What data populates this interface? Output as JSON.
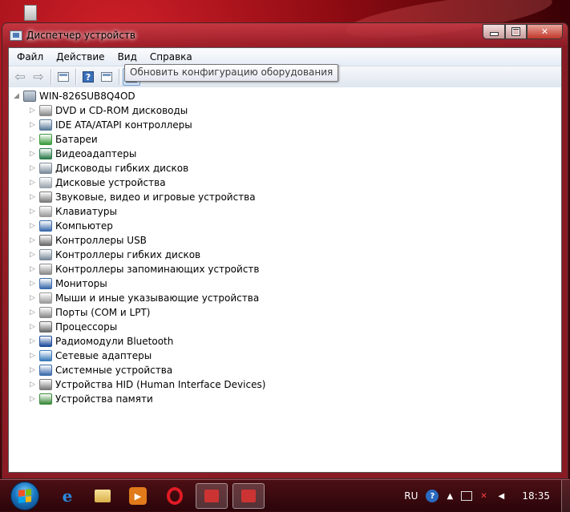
{
  "window": {
    "title": "Диспетчер устройств"
  },
  "menu": [
    "Файл",
    "Действие",
    "Вид",
    "Справка"
  ],
  "toolbar": {
    "tooltip": "Обновить конфигурацию оборудования"
  },
  "tree": {
    "root": "WIN-826SUB8Q4OD",
    "items": [
      {
        "label": "DVD и CD-ROM дисководы",
        "icon": "dvd-drive-icon",
        "color": "#8a8a8a"
      },
      {
        "label": "IDE ATA/ATAPI контроллеры",
        "icon": "ide-controller-icon",
        "color": "#5a7a9a"
      },
      {
        "label": "Батареи",
        "icon": "battery-icon",
        "color": "#3a9a3a"
      },
      {
        "label": "Видеоадаптеры",
        "icon": "video-adapter-icon",
        "color": "#2a7a4a"
      },
      {
        "label": "Дисководы гибких дисков",
        "icon": "floppy-drive-icon",
        "color": "#7a8a9a"
      },
      {
        "label": "Дисковые устройства",
        "icon": "disk-drive-icon",
        "color": "#9aa4ae"
      },
      {
        "label": "Звуковые, видео и игровые устройства",
        "icon": "speaker-icon",
        "color": "#7a7a7a"
      },
      {
        "label": "Клавиатуры",
        "icon": "keyboard-icon",
        "color": "#9a9a9a"
      },
      {
        "label": "Компьютер",
        "icon": "computer-icon",
        "color": "#3a6aaa"
      },
      {
        "label": "Контроллеры USB",
        "icon": "usb-icon",
        "color": "#6a6a6a"
      },
      {
        "label": "Контроллеры гибких дисков",
        "icon": "floppy-controller-icon",
        "color": "#7a8a9a"
      },
      {
        "label": "Контроллеры запоминающих устройств",
        "icon": "storage-controller-icon",
        "color": "#8a8a8a"
      },
      {
        "label": "Мониторы",
        "icon": "monitor-icon",
        "color": "#3a6aaa"
      },
      {
        "label": "Мыши и иные указывающие устройства",
        "icon": "mouse-icon",
        "color": "#9a9a9a"
      },
      {
        "label": "Порты (COM и LPT)",
        "icon": "port-icon",
        "color": "#8a8a8a"
      },
      {
        "label": "Процессоры",
        "icon": "processor-icon",
        "color": "#6a6a6a"
      },
      {
        "label": "Радиомодули Bluetooth",
        "icon": "bluetooth-icon",
        "color": "#1a4a9a"
      },
      {
        "label": "Сетевые адаптеры",
        "icon": "network-adapter-icon",
        "color": "#3a7aba"
      },
      {
        "label": "Системные устройства",
        "icon": "system-device-icon",
        "color": "#3a6aaa"
      },
      {
        "label": "Устройства HID (Human Interface Devices)",
        "icon": "hid-icon",
        "color": "#7a7a7a"
      },
      {
        "label": "Устройства памяти",
        "icon": "memory-icon",
        "color": "#3a8a3a"
      }
    ]
  },
  "taskbar": {
    "language": "RU",
    "time": "18:35"
  }
}
